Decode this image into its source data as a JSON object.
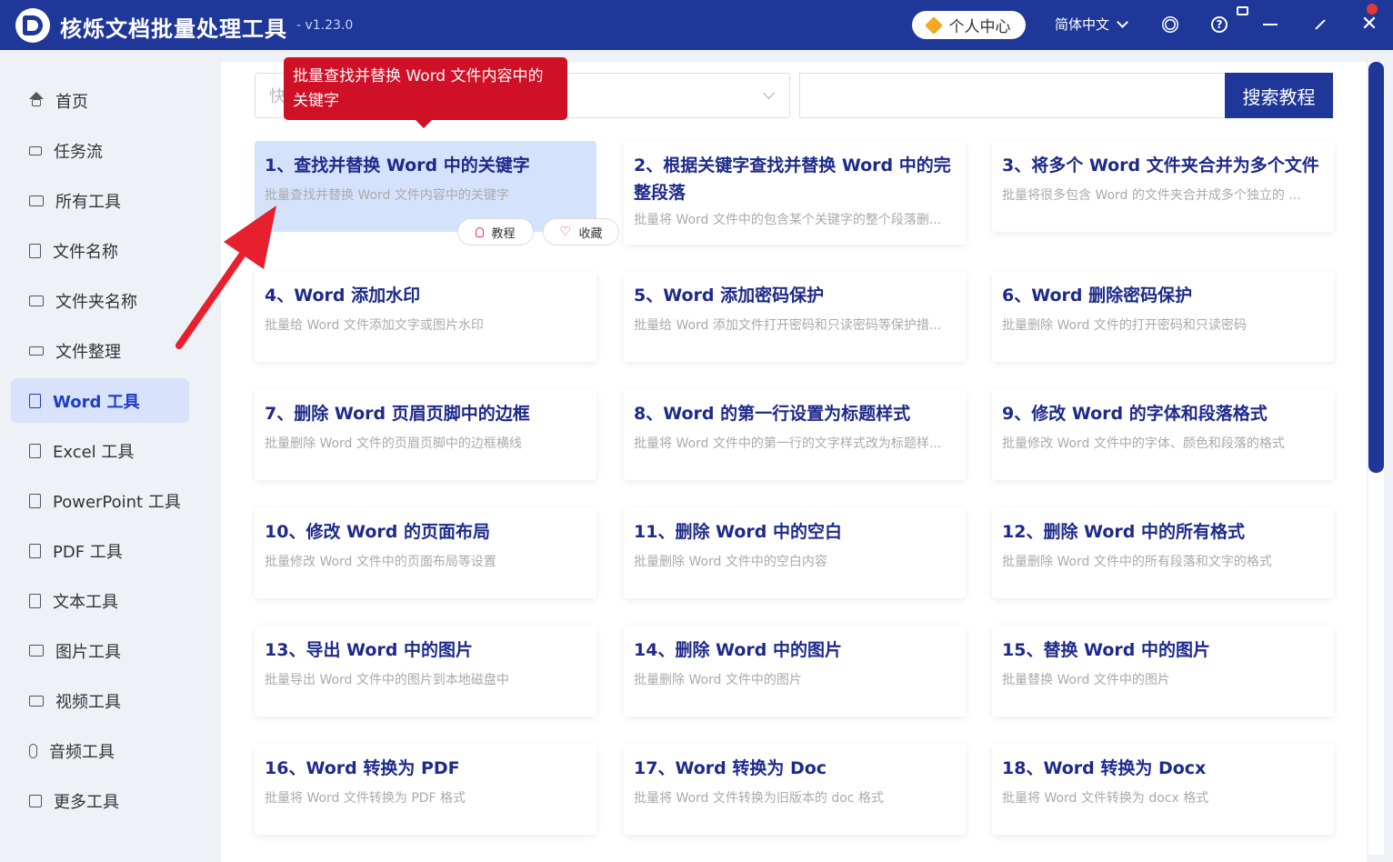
{
  "app": {
    "title": "核烁文档批量处理工具",
    "version": "- v1.23.0",
    "user_center": "个人中心",
    "language": "简体中文"
  },
  "sidebar": {
    "items": [
      {
        "label": "首页",
        "icon": "home-icon"
      },
      {
        "label": "任务流",
        "icon": "workflow-icon"
      },
      {
        "label": "所有工具",
        "icon": "monitor-icon"
      },
      {
        "label": "文件名称",
        "icon": "file-name-icon"
      },
      {
        "label": "文件夹名称",
        "icon": "folder-icon"
      },
      {
        "label": "文件整理",
        "icon": "organize-icon"
      },
      {
        "label": "Word 工具",
        "icon": "word-icon",
        "active": true
      },
      {
        "label": "Excel 工具",
        "icon": "excel-icon"
      },
      {
        "label": "PowerPoint 工具",
        "icon": "powerpoint-icon"
      },
      {
        "label": "PDF 工具",
        "icon": "pdf-icon"
      },
      {
        "label": "文本工具",
        "icon": "text-icon"
      },
      {
        "label": "图片工具",
        "icon": "image-icon"
      },
      {
        "label": "视频工具",
        "icon": "video-icon"
      },
      {
        "label": "音频工具",
        "icon": "audio-icon"
      },
      {
        "label": "更多工具",
        "icon": "grid-icon"
      }
    ]
  },
  "search": {
    "filter_placeholder": "快",
    "input_value": "",
    "button_label": "搜索教程"
  },
  "tooltip": {
    "text": "批量查找并替换 Word 文件内容中的关键字"
  },
  "card_actions": {
    "tutorial": "教程",
    "favorite": "收藏"
  },
  "cards": [
    {
      "title": "1、查找并替换 Word 中的关键字",
      "desc": "批量查找并替换 Word 文件内容中的关键字"
    },
    {
      "title": "2、根据关键字查找并替换 Word 中的完整段落",
      "desc": "批量将 Word 文件中的包含某个关键字的整个段落删..."
    },
    {
      "title": "3、将多个 Word 文件夹合并为多个文件",
      "desc": "批量将很多包含 Word 的文件夹合并成多个独立的 ..."
    },
    {
      "title": "4、Word 添加水印",
      "desc": "批量给 Word 文件添加文字或图片水印"
    },
    {
      "title": "5、Word 添加密码保护",
      "desc": "批量给 Word 添加文件打开密码和只读密码等保护措..."
    },
    {
      "title": "6、Word 删除密码保护",
      "desc": "批量删除 Word 文件的打开密码和只读密码"
    },
    {
      "title": "7、删除 Word 页眉页脚中的边框",
      "desc": "批量删除 Word 文件的页眉页脚中的边框横线"
    },
    {
      "title": "8、Word 的第一行设置为标题样式",
      "desc": "批量将 Word 文件中的第一行的文字样式改为标题样..."
    },
    {
      "title": "9、修改 Word 的字体和段落格式",
      "desc": "批量修改 Word 文件中的字体、颜色和段落的格式"
    },
    {
      "title": "10、修改 Word 的页面布局",
      "desc": "批量修改 Word 文件中的页面布局等设置"
    },
    {
      "title": "11、删除 Word 中的空白",
      "desc": "批量删除 Word 文件中的空白内容"
    },
    {
      "title": "12、删除 Word 中的所有格式",
      "desc": "批量删除 Word 文件中的所有段落和文字的格式"
    },
    {
      "title": "13、导出 Word 中的图片",
      "desc": "批量导出 Word 文件中的图片到本地磁盘中"
    },
    {
      "title": "14、删除 Word 中的图片",
      "desc": "批量删除 Word 文件中的图片"
    },
    {
      "title": "15、替换 Word 中的图片",
      "desc": "批量替换 Word 文件中的图片"
    },
    {
      "title": "16、Word 转换为 PDF",
      "desc": "批量将 Word 文件转换为 PDF 格式"
    },
    {
      "title": "17、Word 转换为 Doc",
      "desc": "批量将 Word 文件转换为旧版本的 doc 格式"
    },
    {
      "title": "18、Word 转换为 Docx",
      "desc": "批量将 Word 文件转换为 docx 格式"
    }
  ],
  "colors": {
    "brand": "#1e3799",
    "tooltip": "#cf1026",
    "arrow": "#e8202e",
    "highlight_card": "#d5e2fc"
  }
}
